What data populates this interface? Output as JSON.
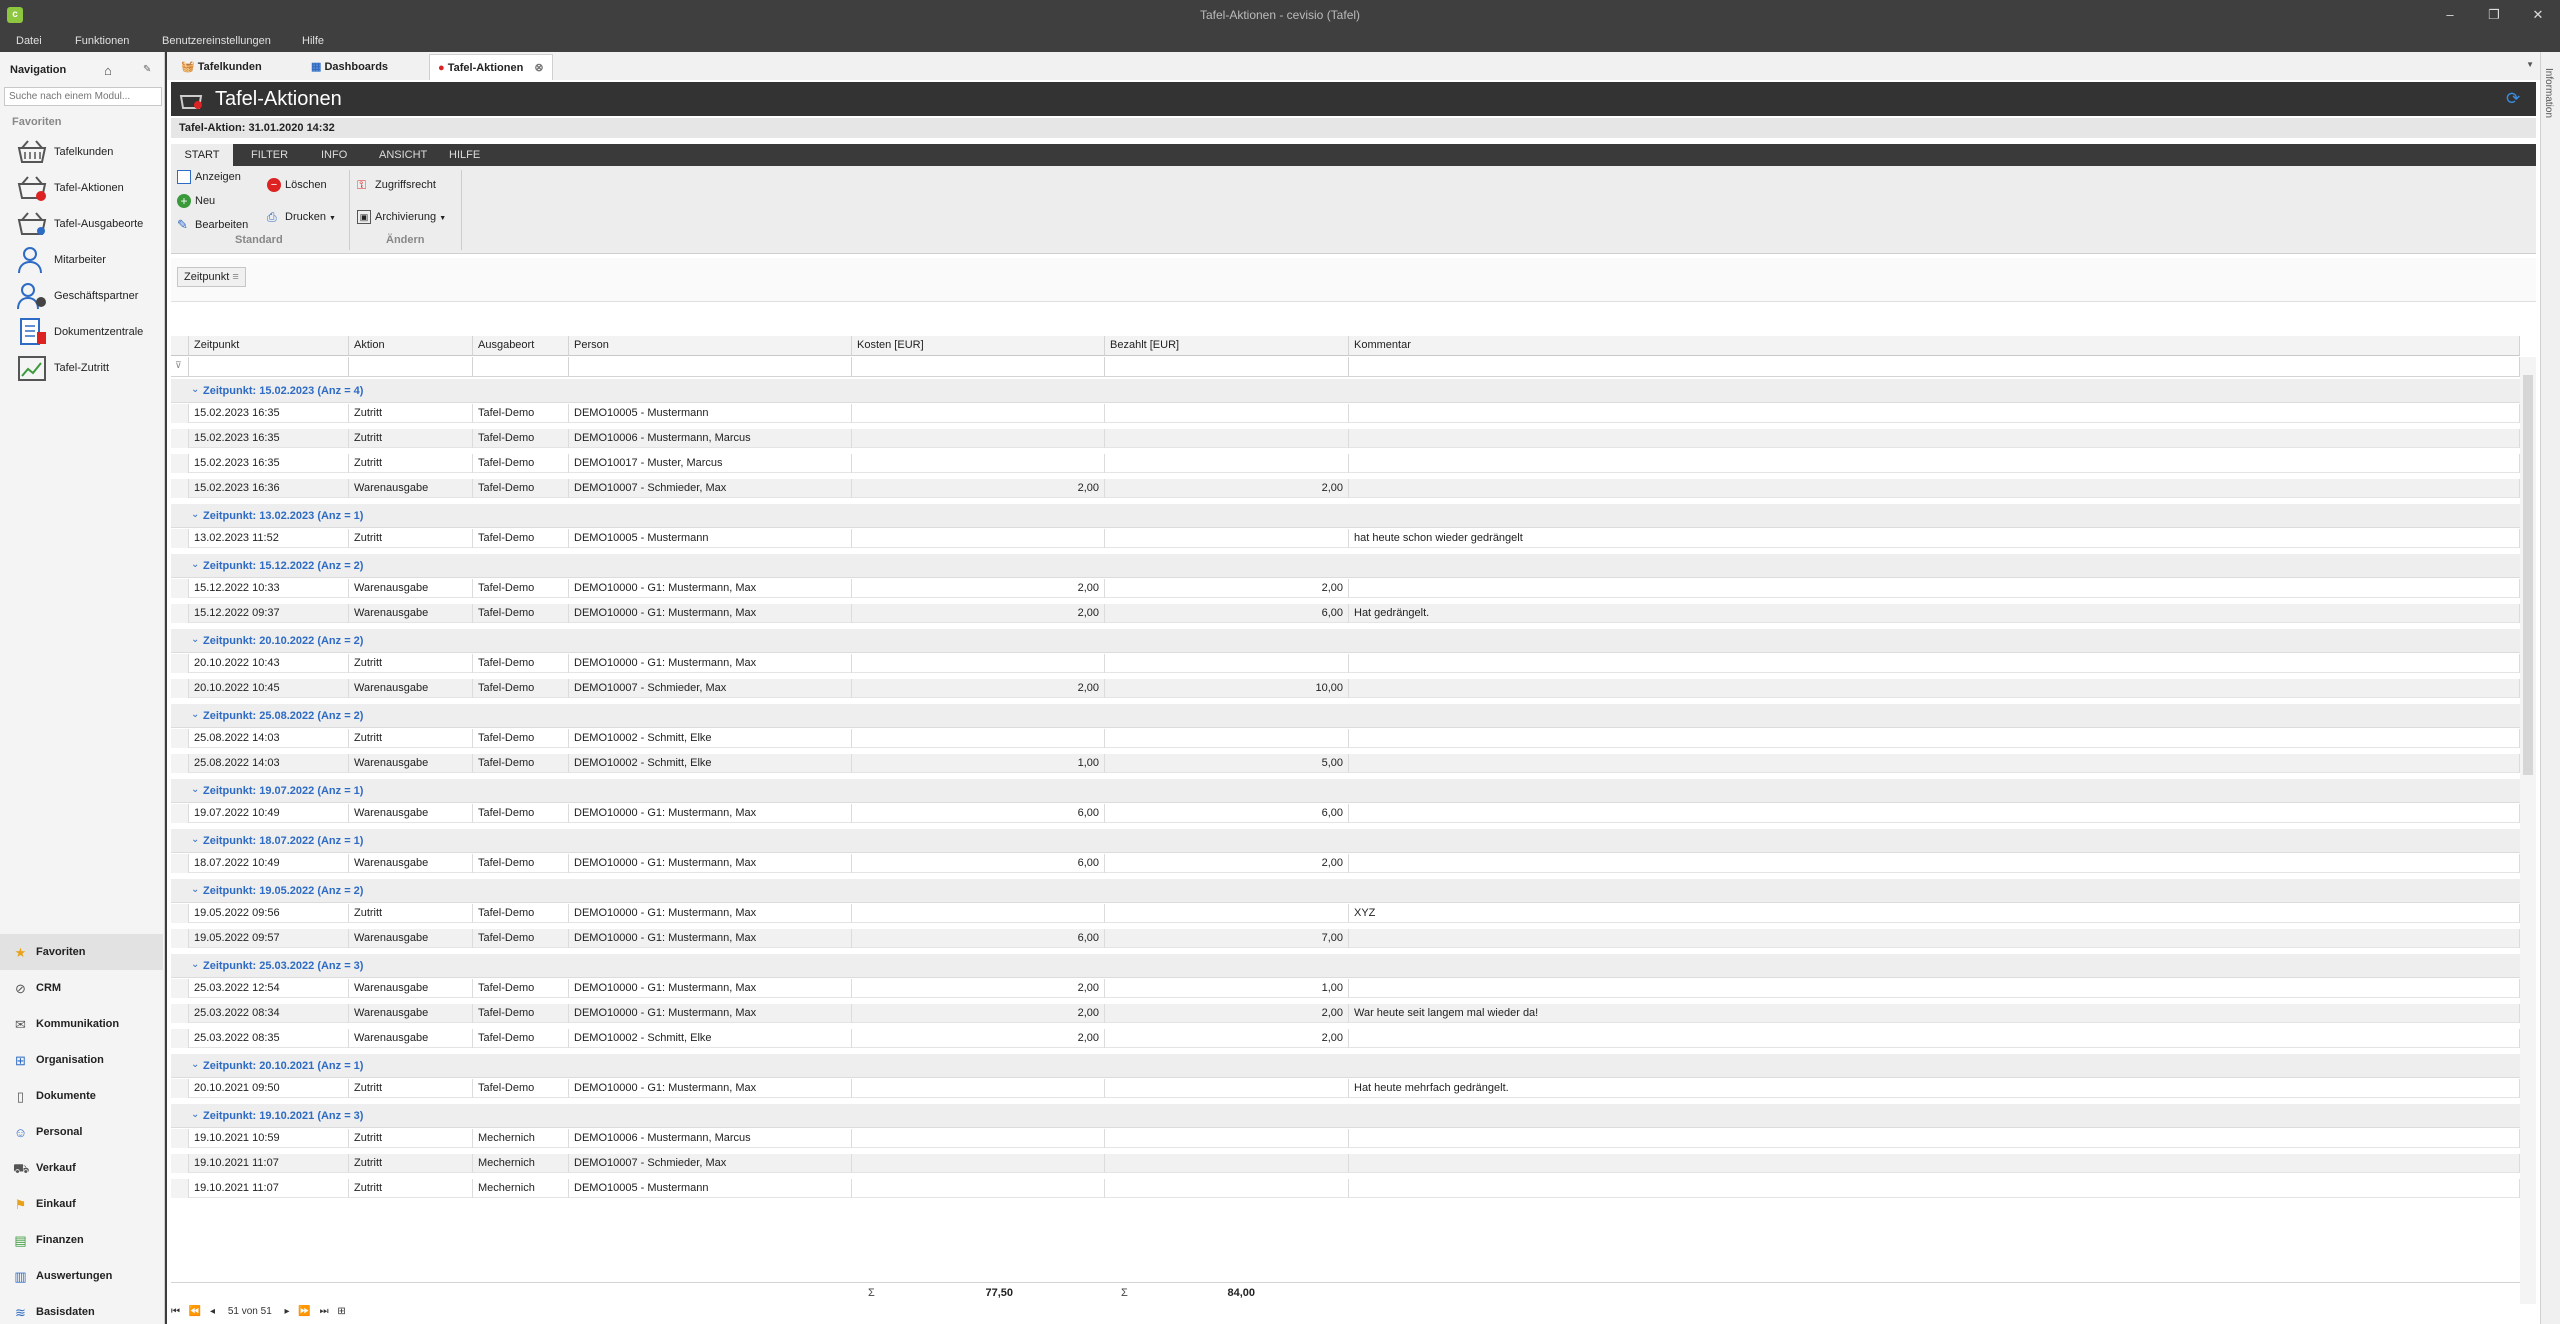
{
  "window": {
    "title": "Tafel-Aktionen - cevisio (Tafel)",
    "app_icon": "c"
  },
  "menu": [
    "Datei",
    "Funktionen",
    "Benutzereinstellungen",
    "Hilfe"
  ],
  "nav": {
    "title": "Navigation",
    "search_placeholder": "Suche nach einem Modul...",
    "favorites_header": "Favoriten",
    "favorites": [
      "Tafelkunden",
      "Tafel-Aktionen",
      "Tafel-Ausgabeorte",
      "Mitarbeiter",
      "Geschäftspartner",
      "Dokumentzentrale",
      "Tafel-Zutritt"
    ],
    "modules": [
      "Favoriten",
      "CRM",
      "Kommunikation",
      "Organisation",
      "Dokumente",
      "Personal",
      "Verkauf",
      "Einkauf",
      "Finanzen",
      "Auswertungen",
      "Basisdaten"
    ]
  },
  "doc_tabs": [
    "Tafelkunden",
    "Dashboards",
    "Tafel-Aktionen"
  ],
  "info_panel": "Information",
  "module": {
    "title": "Tafel-Aktionen",
    "record": "Tafel-Aktion: 31.01.2020 14:32"
  },
  "ribbon": {
    "tabs": [
      "START",
      "FILTER",
      "INFO",
      "ANSICHT",
      "HILFE"
    ],
    "anzeigen": "Anzeigen",
    "neu": "Neu",
    "bearbeiten": "Bearbeiten",
    "loeschen": "Löschen",
    "drucken": "Drucken",
    "zugriffsrecht": "Zugriffsrecht",
    "archivierung": "Archivierung",
    "group_standard": "Standard",
    "group_aendern": "Ändern"
  },
  "group_chip": "Zeitpunkt",
  "columns": [
    "Zeitpunkt",
    "Aktion",
    "Ausgabeort",
    "Person",
    "Kosten [EUR]",
    "Bezahlt [EUR]",
    "Kommentar"
  ],
  "groups": [
    {
      "label": "Zeitpunkt: 15.02.2023 (Anz = 4)",
      "rows": [
        [
          "15.02.2023 16:35",
          "Zutritt",
          "Tafel-Demo",
          "DEMO10005 - Mustermann",
          "",
          "",
          ""
        ],
        [
          "15.02.2023 16:35",
          "Zutritt",
          "Tafel-Demo",
          "DEMO10006 - Mustermann, Marcus",
          "",
          "",
          ""
        ],
        [
          "15.02.2023 16:35",
          "Zutritt",
          "Tafel-Demo",
          "DEMO10017 - Muster, Marcus",
          "",
          "",
          ""
        ],
        [
          "15.02.2023 16:36",
          "Warenausgabe",
          "Tafel-Demo",
          "DEMO10007 - Schmieder, Max",
          "2,00",
          "2,00",
          ""
        ]
      ]
    },
    {
      "label": "Zeitpunkt: 13.02.2023 (Anz = 1)",
      "rows": [
        [
          "13.02.2023 11:52",
          "Zutritt",
          "Tafel-Demo",
          "DEMO10005 - Mustermann",
          "",
          "",
          "hat heute schon wieder gedrängelt"
        ]
      ]
    },
    {
      "label": "Zeitpunkt: 15.12.2022 (Anz = 2)",
      "rows": [
        [
          "15.12.2022 10:33",
          "Warenausgabe",
          "Tafel-Demo",
          "DEMO10000 - G1: Mustermann, Max",
          "2,00",
          "2,00",
          ""
        ],
        [
          "15.12.2022 09:37",
          "Warenausgabe",
          "Tafel-Demo",
          "DEMO10000 - G1: Mustermann, Max",
          "2,00",
          "6,00",
          "Hat gedrängelt."
        ]
      ]
    },
    {
      "label": "Zeitpunkt: 20.10.2022 (Anz = 2)",
      "rows": [
        [
          "20.10.2022 10:43",
          "Zutritt",
          "Tafel-Demo",
          "DEMO10000 - G1: Mustermann, Max",
          "",
          "",
          ""
        ],
        [
          "20.10.2022 10:45",
          "Warenausgabe",
          "Tafel-Demo",
          "DEMO10007 - Schmieder, Max",
          "2,00",
          "10,00",
          ""
        ]
      ]
    },
    {
      "label": "Zeitpunkt: 25.08.2022 (Anz = 2)",
      "rows": [
        [
          "25.08.2022 14:03",
          "Zutritt",
          "Tafel-Demo",
          "DEMO10002 - Schmitt, Elke",
          "",
          "",
          ""
        ],
        [
          "25.08.2022 14:03",
          "Warenausgabe",
          "Tafel-Demo",
          "DEMO10002 - Schmitt, Elke",
          "1,00",
          "5,00",
          ""
        ]
      ]
    },
    {
      "label": "Zeitpunkt: 19.07.2022 (Anz = 1)",
      "rows": [
        [
          "19.07.2022 10:49",
          "Warenausgabe",
          "Tafel-Demo",
          "DEMO10000 - G1: Mustermann, Max",
          "6,00",
          "6,00",
          ""
        ]
      ]
    },
    {
      "label": "Zeitpunkt: 18.07.2022 (Anz = 1)",
      "rows": [
        [
          "18.07.2022 10:49",
          "Warenausgabe",
          "Tafel-Demo",
          "DEMO10000 - G1: Mustermann, Max",
          "6,00",
          "2,00",
          ""
        ]
      ]
    },
    {
      "label": "Zeitpunkt: 19.05.2022 (Anz = 2)",
      "rows": [
        [
          "19.05.2022 09:56",
          "Zutritt",
          "Tafel-Demo",
          "DEMO10000 - G1: Mustermann, Max",
          "",
          "",
          "XYZ"
        ],
        [
          "19.05.2022 09:57",
          "Warenausgabe",
          "Tafel-Demo",
          "DEMO10000 - G1: Mustermann, Max",
          "6,00",
          "7,00",
          ""
        ]
      ]
    },
    {
      "label": "Zeitpunkt: 25.03.2022 (Anz = 3)",
      "rows": [
        [
          "25.03.2022 12:54",
          "Warenausgabe",
          "Tafel-Demo",
          "DEMO10000 - G1: Mustermann, Max",
          "2,00",
          "1,00",
          ""
        ],
        [
          "25.03.2022 08:34",
          "Warenausgabe",
          "Tafel-Demo",
          "DEMO10000 - G1: Mustermann, Max",
          "2,00",
          "2,00",
          "War heute seit langem mal wieder da!"
        ],
        [
          "25.03.2022 08:35",
          "Warenausgabe",
          "Tafel-Demo",
          "DEMO10002 - Schmitt, Elke",
          "2,00",
          "2,00",
          ""
        ]
      ]
    },
    {
      "label": "Zeitpunkt: 20.10.2021 (Anz = 1)",
      "rows": [
        [
          "20.10.2021 09:50",
          "Zutritt",
          "Tafel-Demo",
          "DEMO10000 - G1: Mustermann, Max",
          "",
          "",
          "Hat heute mehrfach gedrängelt."
        ]
      ]
    },
    {
      "label": "Zeitpunkt: 19.10.2021 (Anz = 3)",
      "rows": [
        [
          "19.10.2021 10:59",
          "Zutritt",
          "Mechernich",
          "DEMO10006 - Mustermann, Marcus",
          "",
          "",
          ""
        ],
        [
          "19.10.2021 11:07",
          "Zutritt",
          "Mechernich",
          "DEMO10007 - Schmieder, Max",
          "",
          "",
          ""
        ],
        [
          "19.10.2021 11:07",
          "Zutritt",
          "Mechernich",
          "DEMO10005 - Mustermann",
          "",
          "",
          ""
        ]
      ]
    }
  ],
  "totals": {
    "kosten": "77,50",
    "bezahlt": "84,00"
  },
  "pager": "51 von 51",
  "colors": {
    "accent": "#2e6bc4",
    "header": "#333333",
    "titlebar": "#3f3f3f"
  }
}
